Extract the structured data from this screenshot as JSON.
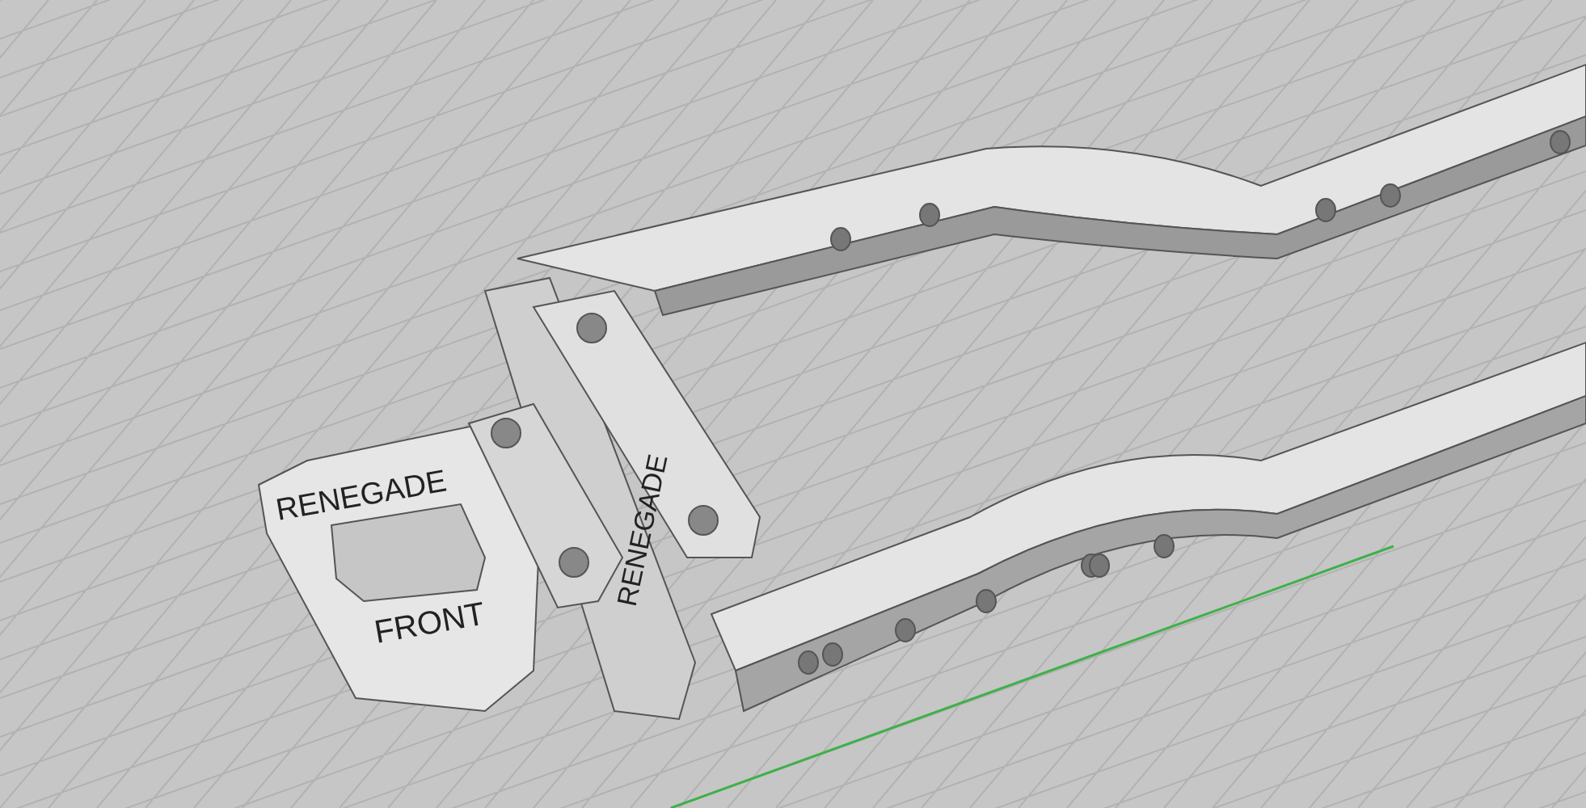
{
  "viewport": {
    "model_labels": [
      {
        "text": "RENEGADE"
      },
      {
        "text": "FRONT"
      },
      {
        "text": "RENEGADE"
      }
    ]
  }
}
